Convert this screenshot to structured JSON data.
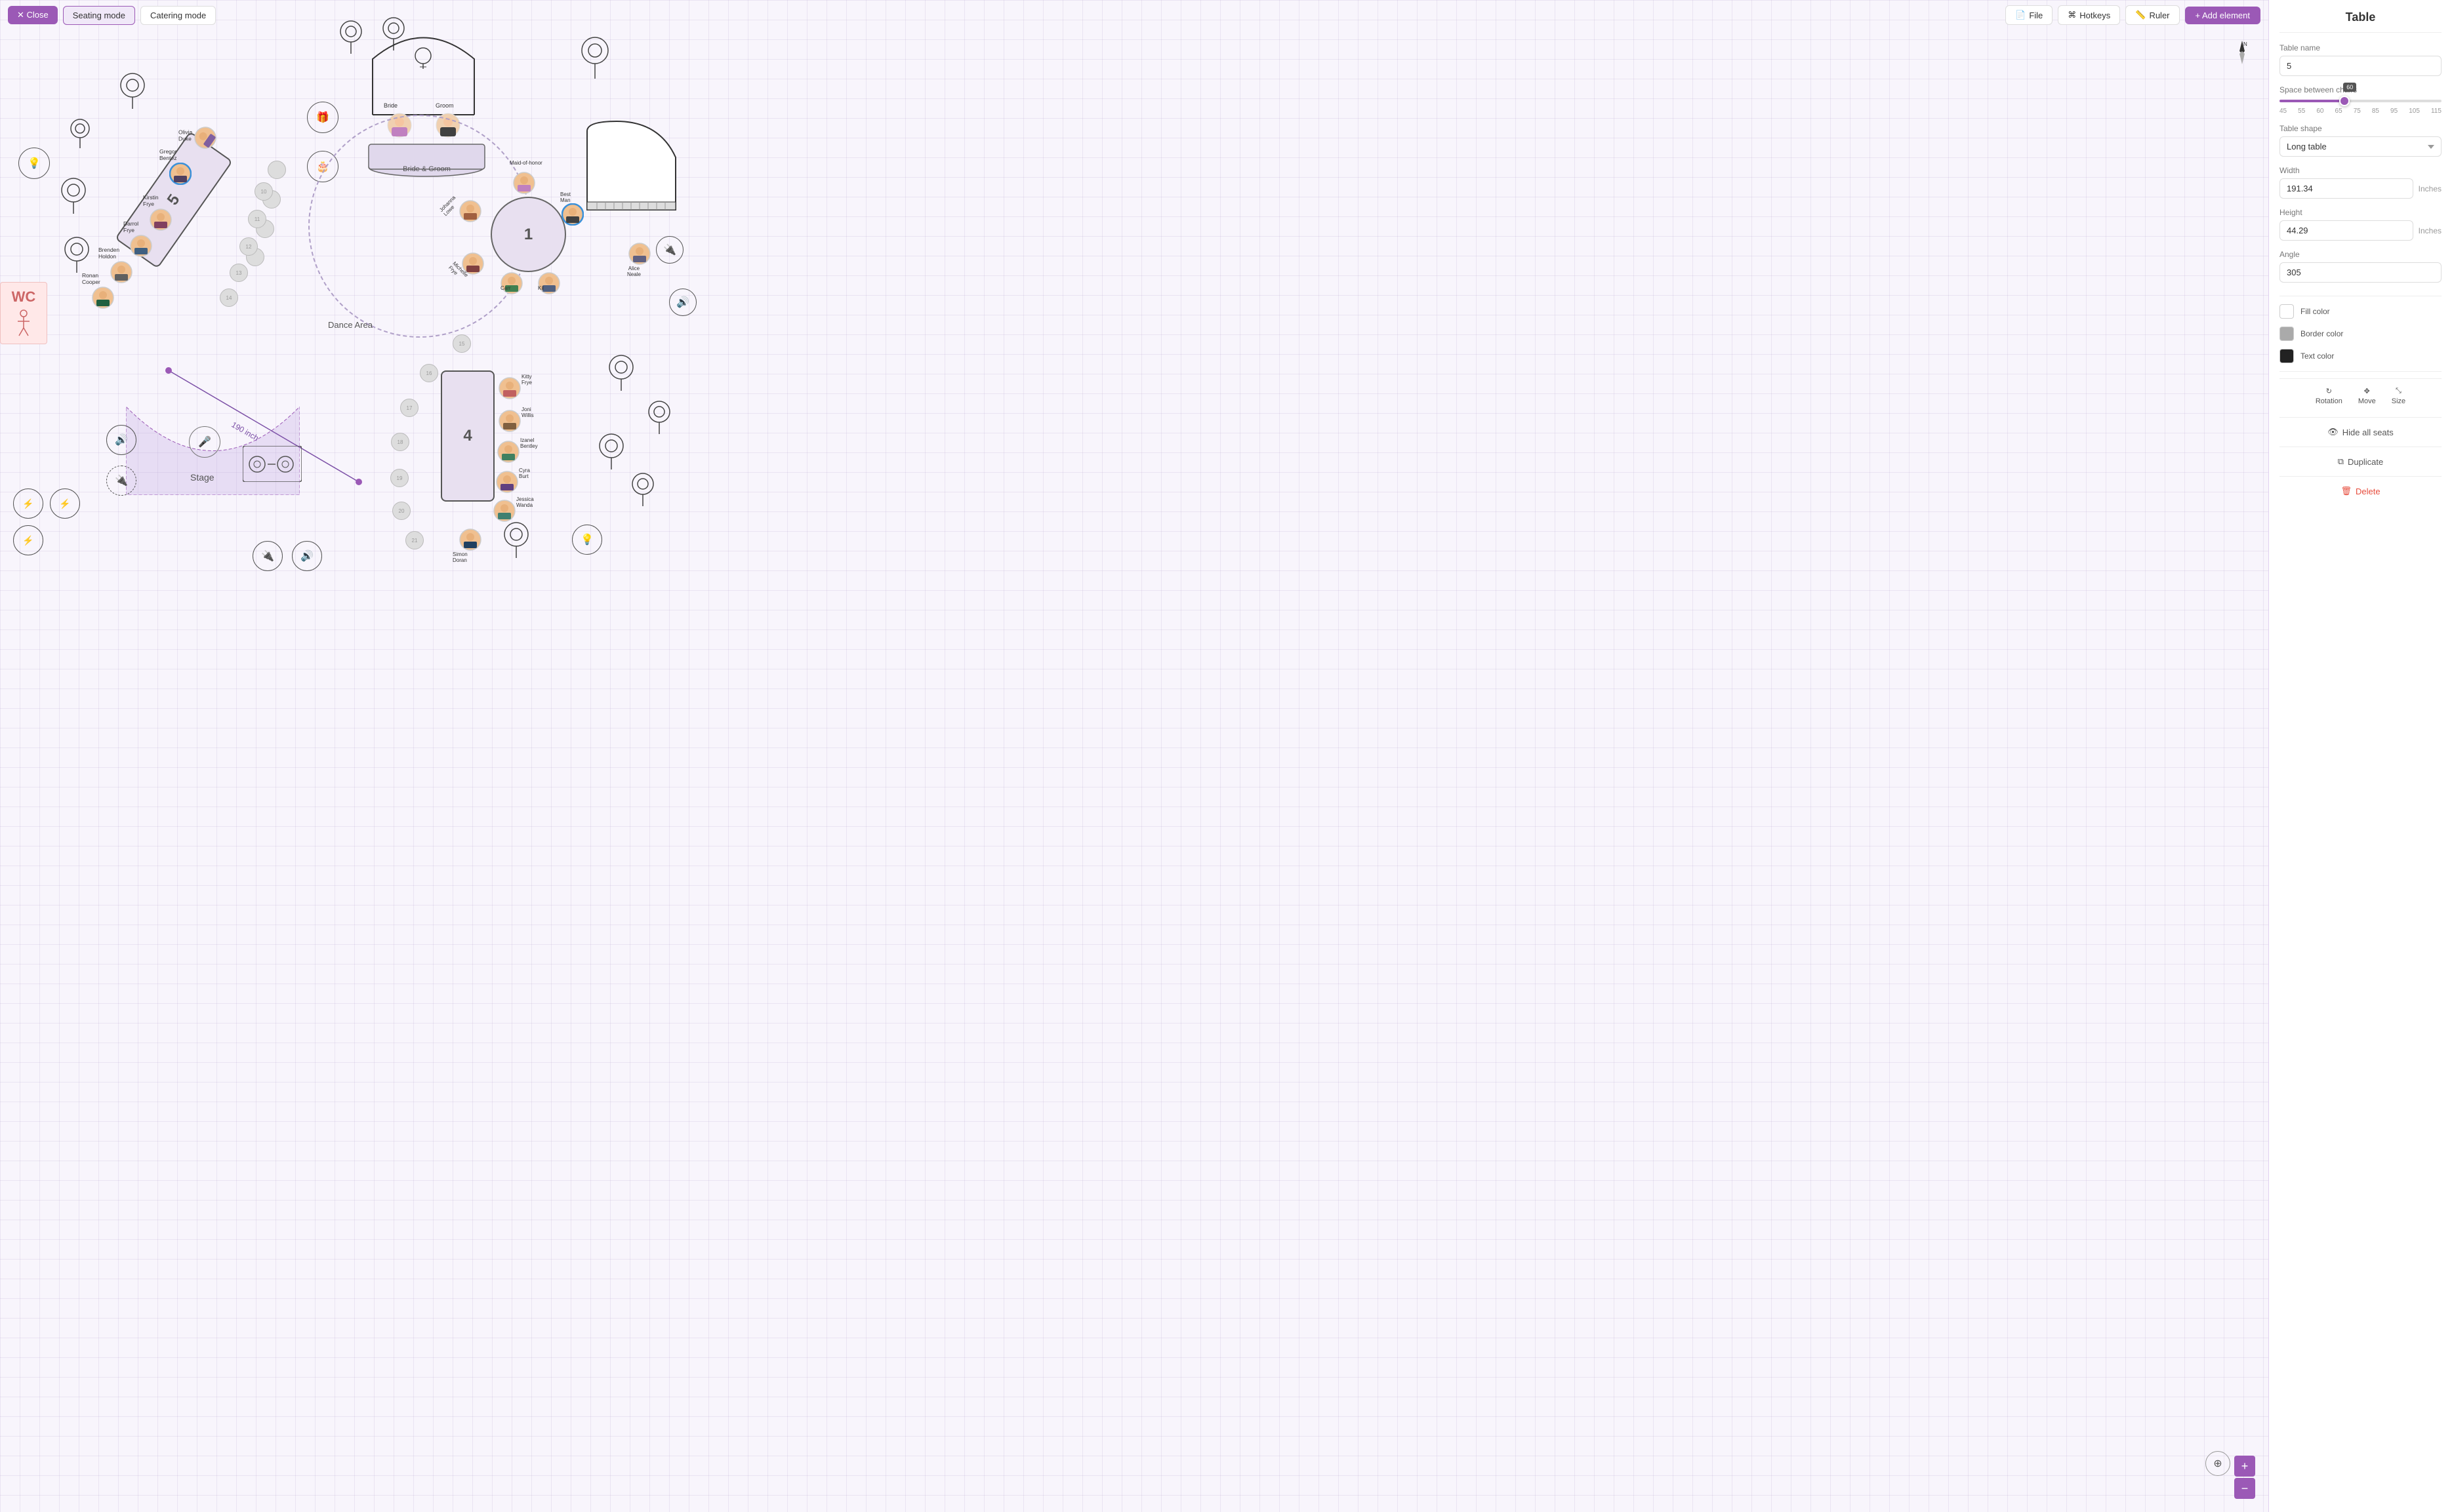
{
  "toolbar": {
    "close_label": "✕  Close",
    "seating_mode_label": "Seating mode",
    "catering_mode_label": "Catering mode",
    "file_label": "File",
    "hotkeys_label": "Hotkeys",
    "ruler_label": "Ruler",
    "add_element_label": "+ Add element"
  },
  "canvas": {
    "dance_area_label": "Dance Area",
    "stage_label": "Stage",
    "measure_label": "190 inch",
    "table5_label": "5",
    "table4_label": "4",
    "table1_label": "1",
    "bride_groom_label": "Bride & Groom",
    "bride_label": "Bride",
    "groom_label": "Groom",
    "wc_label": "WC"
  },
  "panel": {
    "title": "Table",
    "table_name_label": "Table name",
    "table_name_value": "5",
    "space_between_chairs_label": "Space between chairs",
    "slider_value": "60",
    "slider_marks": [
      "45",
      "55",
      "60",
      "65",
      "75",
      "85",
      "95",
      "105",
      "115"
    ],
    "table_shape_label": "Table shape",
    "table_shape_value": "Long table",
    "width_label": "Width",
    "width_value": "191.34",
    "width_unit": "Inches",
    "height_label": "Height",
    "height_value": "44.29",
    "height_unit": "Inches",
    "angle_label": "Angle",
    "angle_value": "305",
    "fill_color_label": "Fill color",
    "border_color_label": "Border color",
    "text_color_label": "Text color",
    "rotation_label": "Rotation",
    "move_label": "Move",
    "size_label": "Size",
    "hide_seats_label": "Hide all seats",
    "duplicate_label": "Duplicate",
    "delete_label": "Delete"
  }
}
